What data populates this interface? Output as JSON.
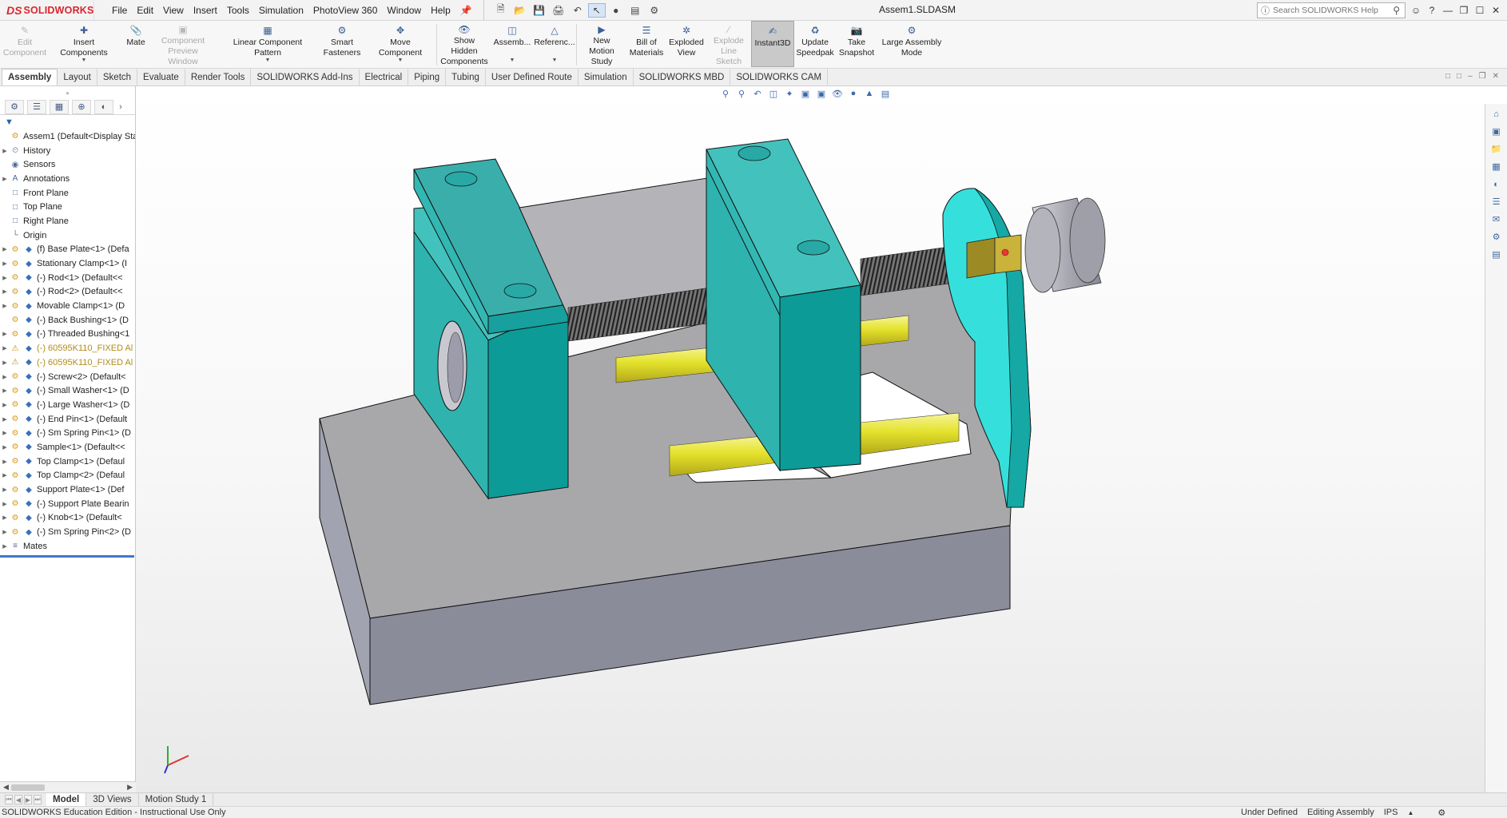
{
  "app": {
    "brand_ds": "DS",
    "brand_name": "SOLIDWORKS",
    "document_title": "Assem1.SLDASM"
  },
  "menus": [
    "File",
    "Edit",
    "View",
    "Insert",
    "Tools",
    "Simulation",
    "PhotoView 360",
    "Window",
    "Help"
  ],
  "search": {
    "placeholder": "Search SOLIDWORKS Help"
  },
  "toolbar": [
    {
      "label_1": "Edit",
      "label_2": "Component",
      "icon": "edit-component-icon",
      "disabled": true
    },
    {
      "label_1": "Insert Components",
      "label_2": "",
      "icon": "insert-components-icon",
      "disabled": false,
      "dropdown": true
    },
    {
      "label_1": "Mate",
      "label_2": "",
      "icon": "mate-icon",
      "disabled": false
    },
    {
      "label_1": "Component",
      "label_2": "Preview Window",
      "icon": "component-preview-icon",
      "disabled": true
    },
    {
      "label_1": "Linear Component Pattern",
      "label_2": "",
      "icon": "linear-pattern-icon",
      "disabled": false,
      "dropdown": true
    },
    {
      "label_1": "Smart",
      "label_2": "Fasteners",
      "icon": "smart-fasteners-icon",
      "disabled": false
    },
    {
      "label_1": "Move Component",
      "label_2": "",
      "icon": "move-component-icon",
      "disabled": false,
      "dropdown": true
    },
    {
      "label_1": "Show Hidden",
      "label_2": "Components",
      "icon": "show-hidden-icon",
      "disabled": false
    },
    {
      "label_1": "Assemb...",
      "label_2": "",
      "icon": "assembly-features-icon",
      "disabled": false,
      "dropdown": true
    },
    {
      "label_1": "Referenc...",
      "label_2": "",
      "icon": "reference-geometry-icon",
      "disabled": false,
      "dropdown": true
    },
    {
      "label_1": "New Motion",
      "label_2": "Study",
      "icon": "motion-study-icon",
      "disabled": false
    },
    {
      "label_1": "Bill of",
      "label_2": "Materials",
      "icon": "bom-icon",
      "disabled": false
    },
    {
      "label_1": "Exploded",
      "label_2": "View",
      "icon": "exploded-view-icon",
      "disabled": false
    },
    {
      "label_1": "Explode",
      "label_2": "Line Sketch",
      "icon": "explode-line-icon",
      "disabled": true
    },
    {
      "label_1": "Instant3D",
      "label_2": "",
      "icon": "instant3d-icon",
      "disabled": false,
      "active": true
    },
    {
      "label_1": "Update",
      "label_2": "Speedpak",
      "icon": "speedpak-icon",
      "disabled": false
    },
    {
      "label_1": "Take",
      "label_2": "Snapshot",
      "icon": "snapshot-icon",
      "disabled": false
    },
    {
      "label_1": "Large Assembly",
      "label_2": "Mode",
      "icon": "large-assembly-icon",
      "disabled": false
    }
  ],
  "tabs": [
    "Assembly",
    "Layout",
    "Sketch",
    "Evaluate",
    "Render Tools",
    "SOLIDWORKS Add-Ins",
    "Electrical",
    "Piping",
    "Tubing",
    "User Defined Route",
    "Simulation",
    "SOLIDWORKS MBD",
    "SOLIDWORKS CAM"
  ],
  "tree": [
    {
      "label": "Assem1  (Default<Display Stat",
      "icon": "assembly-icon",
      "expand": false,
      "root": true
    },
    {
      "label": "History",
      "icon": "history-icon",
      "expand": true
    },
    {
      "label": "Sensors",
      "icon": "sensors-icon",
      "expand": false
    },
    {
      "label": "Annotations",
      "icon": "annotations-icon",
      "expand": true
    },
    {
      "label": "Front Plane",
      "icon": "plane-icon",
      "expand": false
    },
    {
      "label": "Top Plane",
      "icon": "plane-icon",
      "expand": false
    },
    {
      "label": "Right Plane",
      "icon": "plane-icon",
      "expand": false
    },
    {
      "label": "Origin",
      "icon": "origin-icon",
      "expand": false
    },
    {
      "label": "(f) Base Plate<1> (Defa",
      "icon": "component-icon",
      "expand": true
    },
    {
      "label": "Stationary Clamp<1> (I",
      "icon": "component-icon",
      "expand": true
    },
    {
      "label": "(-) Rod<1> (Default<<",
      "icon": "component-icon",
      "expand": true
    },
    {
      "label": "(-) Rod<2> (Default<<",
      "icon": "component-icon",
      "expand": true
    },
    {
      "label": "Movable Clamp<1> (D",
      "icon": "component-icon",
      "expand": true
    },
    {
      "label": "(-) Back Bushing<1> (D",
      "icon": "component-icon",
      "expand": false
    },
    {
      "label": "(-) Threaded Bushing<1",
      "icon": "component-icon",
      "expand": true
    },
    {
      "label": "(-) 60595K110_FIXED Al",
      "icon": "warning-icon",
      "expand": true,
      "warn": true
    },
    {
      "label": "(-) 60595K110_FIXED Al",
      "icon": "warning-icon",
      "expand": true,
      "warn": true
    },
    {
      "label": "(-) Screw<2> (Default<",
      "icon": "component-icon",
      "expand": true
    },
    {
      "label": "(-) Small Washer<1> (D",
      "icon": "component-icon",
      "expand": true
    },
    {
      "label": "(-) Large Washer<1> (D",
      "icon": "component-icon",
      "expand": true
    },
    {
      "label": "(-) End Pin<1> (Default",
      "icon": "component-icon",
      "expand": true
    },
    {
      "label": "(-) Sm Spring Pin<1> (D",
      "icon": "component-icon",
      "expand": true
    },
    {
      "label": "Sample<1> (Default<<",
      "icon": "component-icon",
      "expand": true
    },
    {
      "label": "Top Clamp<1> (Defaul",
      "icon": "component-icon",
      "expand": true
    },
    {
      "label": "Top Clamp<2> (Defaul",
      "icon": "component-icon",
      "expand": true
    },
    {
      "label": "Support Plate<1> (Def",
      "icon": "component-icon",
      "expand": true
    },
    {
      "label": "(-) Support Plate Bearin",
      "icon": "component-icon",
      "expand": true
    },
    {
      "label": "(-) Knob<1> (Default<",
      "icon": "component-icon",
      "expand": true
    },
    {
      "label": "(-) Sm Spring Pin<2> (D",
      "icon": "component-icon",
      "expand": true
    },
    {
      "label": "Mates",
      "icon": "mates-icon",
      "expand": true
    }
  ],
  "bottom_tabs": [
    "Model",
    "3D Views",
    "Motion Study 1"
  ],
  "status": {
    "edition": "SOLIDWORKS Education Edition - Instructional Use Only",
    "definition": "Under Defined",
    "mode": "Editing Assembly",
    "units": "IPS"
  },
  "colors": {
    "teal": "#35b8b4",
    "teal_dark": "#0d9b98",
    "gray_top": "#a7a7aa",
    "gray_side": "#8b8c99",
    "rod": "#e4e22c",
    "brand_red": "#d9262e"
  }
}
